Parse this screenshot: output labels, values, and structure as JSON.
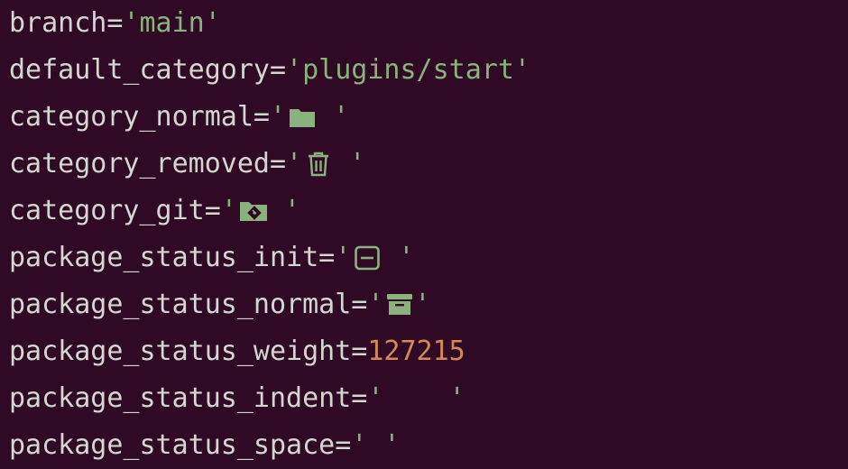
{
  "colors": {
    "background": "#300a24",
    "key_text": "#d3d7cf",
    "string": "#8ab27e",
    "number": "#d08a5a"
  },
  "lines": [
    {
      "key": "branch=",
      "open": "'",
      "value": "main",
      "close": "'"
    },
    {
      "key": "default_category=",
      "open": "'",
      "value": "plugins/start",
      "close": "'"
    },
    {
      "key": "category_normal=",
      "open": "'",
      "icon": "folder-icon",
      "close": " '"
    },
    {
      "key": "category_removed=",
      "open": "'",
      "icon": "trash-icon",
      "close": " '"
    },
    {
      "key": "category_git=",
      "open": "'",
      "icon": "git-folder-icon",
      "close": " '"
    },
    {
      "key": "package_status_init=",
      "open": "'",
      "icon": "minus-square-icon",
      "close": " '"
    },
    {
      "key": "package_status_normal=",
      "open": "'",
      "icon": "archive-icon",
      "close": "'"
    },
    {
      "key": "package_status_weight=",
      "value": "127215"
    },
    {
      "key": "package_status_indent=",
      "open": "'",
      "value": "    ",
      "close": "'"
    },
    {
      "key": "package_status_space=",
      "open": "'",
      "value": " ",
      "close": "'"
    }
  ]
}
